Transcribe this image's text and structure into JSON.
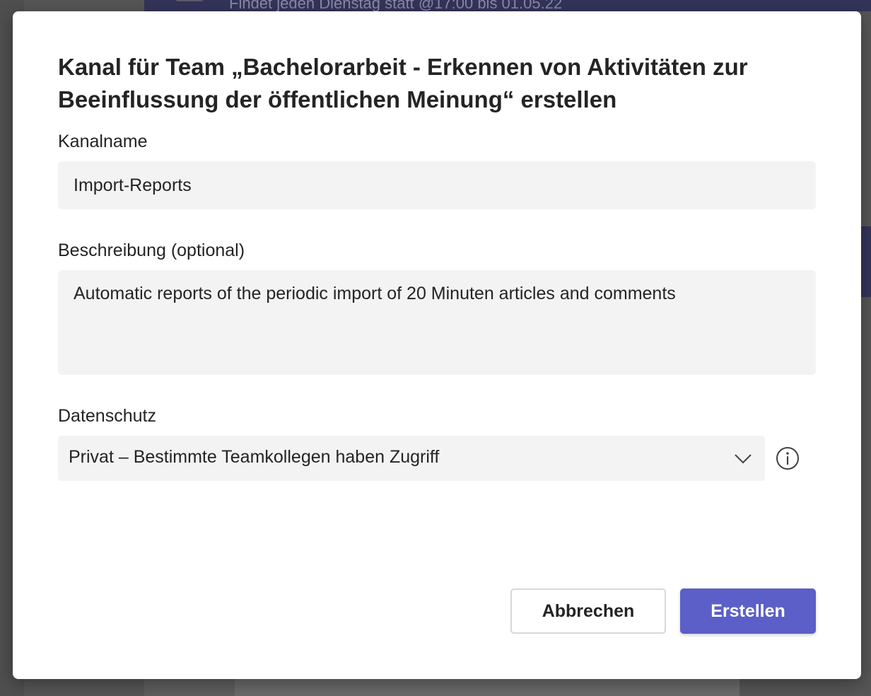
{
  "background": {
    "header_text": "Findet jeden Dienstag statt @17:00 bis 01.05.22"
  },
  "dialog": {
    "title": "Kanal für Team „Bachelorarbeit - Erkennen von Aktivitäten zur Beeinflussung der öffentlichen Meinung“ erstellen",
    "channel_name": {
      "label": "Kanalname",
      "value": "Import-Reports"
    },
    "description": {
      "label": "Beschreibung (optional)",
      "value": "Automatic reports of the periodic import of 20 Minuten articles and comments"
    },
    "privacy": {
      "label": "Datenschutz",
      "selected": "Privat – Bestimmte Teamkollegen haben Zugriff",
      "dropdown_icon": "chevron-down-icon",
      "info_icon": "info-icon"
    },
    "buttons": {
      "cancel": "Abbrechen",
      "create": "Erstellen"
    }
  },
  "colors": {
    "primary": "#5b5fc7",
    "field_background": "#f3f3f3",
    "text": "#242424",
    "overlay": "#565656"
  }
}
